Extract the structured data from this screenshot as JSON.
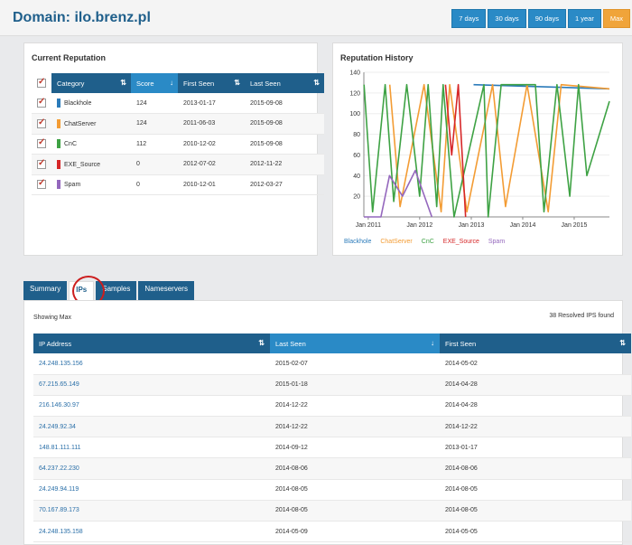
{
  "header": {
    "title": "Domain: ilo.brenz.pl",
    "ranges": [
      {
        "label": "7 days",
        "active": false
      },
      {
        "label": "30 days",
        "active": false
      },
      {
        "label": "90 days",
        "active": false
      },
      {
        "label": "1 year",
        "active": false
      },
      {
        "label": "Max",
        "active": true
      }
    ]
  },
  "colors": {
    "brand": "#1f5f8b",
    "accent": "#2a8ac6",
    "active_range": "#f0a43a",
    "highlight": "#cc1e1e"
  },
  "reputation": {
    "title": "Current Reputation",
    "columns": [
      "Category",
      "Score",
      "First Seen",
      "Last Seen"
    ],
    "rows": [
      {
        "category": "Blackhole",
        "color": "#2b7bba",
        "score": "124",
        "first_seen": "2013-01-17",
        "last_seen": "2015-09-08"
      },
      {
        "category": "ChatServer",
        "color": "#f39c34",
        "score": "124",
        "first_seen": "2011-06-03",
        "last_seen": "2015-09-08"
      },
      {
        "category": "CnC",
        "color": "#3ea244",
        "score": "112",
        "first_seen": "2010-12-02",
        "last_seen": "2015-09-08"
      },
      {
        "category": "EXE_Source",
        "color": "#d62728",
        "score": "0",
        "first_seen": "2012-07-02",
        "last_seen": "2012-11-22"
      },
      {
        "category": "Spam",
        "color": "#9467bd",
        "score": "0",
        "first_seen": "2010-12-01",
        "last_seen": "2012-03-27"
      }
    ]
  },
  "history": {
    "title": "Reputation History",
    "chart_data": {
      "type": "line",
      "xlabel": "",
      "ylabel": "",
      "x_ticks": [
        "Jan 2011",
        "Jan 2012",
        "Jan 2013",
        "Jan 2014",
        "Jan 2015"
      ],
      "y_ticks": [
        20,
        40,
        60,
        80,
        100,
        120,
        140
      ],
      "ylim": [
        0,
        140
      ],
      "xlim": [
        "2010-12-01",
        "2015-09-08"
      ],
      "legend_position": "bottom",
      "series": [
        {
          "name": "Blackhole",
          "color": "#2b7bba",
          "points": [
            [
              "2013-01-17",
              128
            ],
            [
              "2015-09-08",
              124
            ]
          ]
        },
        {
          "name": "ChatServer",
          "color": "#f39c34",
          "points": [
            [
              "2011-06-03",
              128
            ],
            [
              "2011-08-15",
              10
            ],
            [
              "2012-02-01",
              128
            ],
            [
              "2012-06-01",
              5
            ],
            [
              "2012-08-01",
              128
            ],
            [
              "2012-12-01",
              5
            ],
            [
              "2013-06-01",
              128
            ],
            [
              "2013-09-01",
              10
            ],
            [
              "2014-02-01",
              128
            ],
            [
              "2014-07-01",
              5
            ],
            [
              "2014-10-01",
              128
            ],
            [
              "2015-09-08",
              124
            ]
          ]
        },
        {
          "name": "CnC",
          "color": "#3ea244",
          "points": [
            [
              "2010-12-02",
              128
            ],
            [
              "2011-02-01",
              5
            ],
            [
              "2011-05-01",
              128
            ],
            [
              "2011-07-01",
              15
            ],
            [
              "2011-10-01",
              128
            ],
            [
              "2012-01-01",
              20
            ],
            [
              "2012-03-01",
              128
            ],
            [
              "2012-05-01",
              10
            ],
            [
              "2012-06-15",
              128
            ],
            [
              "2012-09-01",
              0
            ],
            [
              "2013-04-01",
              128
            ],
            [
              "2013-05-01",
              0
            ],
            [
              "2013-08-01",
              128
            ],
            [
              "2014-04-01",
              128
            ],
            [
              "2014-06-01",
              5
            ],
            [
              "2014-09-01",
              128
            ],
            [
              "2014-12-01",
              20
            ],
            [
              "2015-02-01",
              128
            ],
            [
              "2015-04-01",
              40
            ],
            [
              "2015-09-08",
              112
            ]
          ]
        },
        {
          "name": "EXE_Source",
          "color": "#d62728",
          "points": [
            [
              "2012-07-02",
              128
            ],
            [
              "2012-08-15",
              60
            ],
            [
              "2012-10-01",
              128
            ],
            [
              "2012-11-22",
              0
            ]
          ]
        },
        {
          "name": "Spam",
          "color": "#9467bd",
          "points": [
            [
              "2010-12-01",
              0
            ],
            [
              "2011-04-01",
              0
            ],
            [
              "2011-06-01",
              40
            ],
            [
              "2011-09-01",
              20
            ],
            [
              "2011-12-01",
              45
            ],
            [
              "2012-03-27",
              0
            ]
          ]
        }
      ]
    }
  },
  "tabs": [
    {
      "label": "Summary",
      "active": false
    },
    {
      "label": "IPs",
      "active": true
    },
    {
      "label": "Samples",
      "active": false
    },
    {
      "label": "Nameservers",
      "active": false
    }
  ],
  "ips": {
    "showing": "Showing Max",
    "found": "38 Resolved IPS found",
    "columns": [
      "IP Address",
      "Last Seen",
      "First Seen"
    ],
    "rows": [
      {
        "ip": "24.248.135.156",
        "last_seen": "2015-02-07",
        "first_seen": "2014-05-02"
      },
      {
        "ip": "67.215.65.149",
        "last_seen": "2015-01-18",
        "first_seen": "2014-04-28"
      },
      {
        "ip": "216.146.30.97",
        "last_seen": "2014-12-22",
        "first_seen": "2014-04-28"
      },
      {
        "ip": "24.249.92.34",
        "last_seen": "2014-12-22",
        "first_seen": "2014-12-22"
      },
      {
        "ip": "148.81.111.111",
        "last_seen": "2014-09-12",
        "first_seen": "2013-01-17"
      },
      {
        "ip": "64.237.22.230",
        "last_seen": "2014-08-06",
        "first_seen": "2014-08-06"
      },
      {
        "ip": "24.249.94.119",
        "last_seen": "2014-08-05",
        "first_seen": "2014-08-05"
      },
      {
        "ip": "70.167.89.173",
        "last_seen": "2014-08-05",
        "first_seen": "2014-08-05"
      },
      {
        "ip": "24.248.135.158",
        "last_seen": "2014-05-09",
        "first_seen": "2014-05-05"
      }
    ]
  }
}
